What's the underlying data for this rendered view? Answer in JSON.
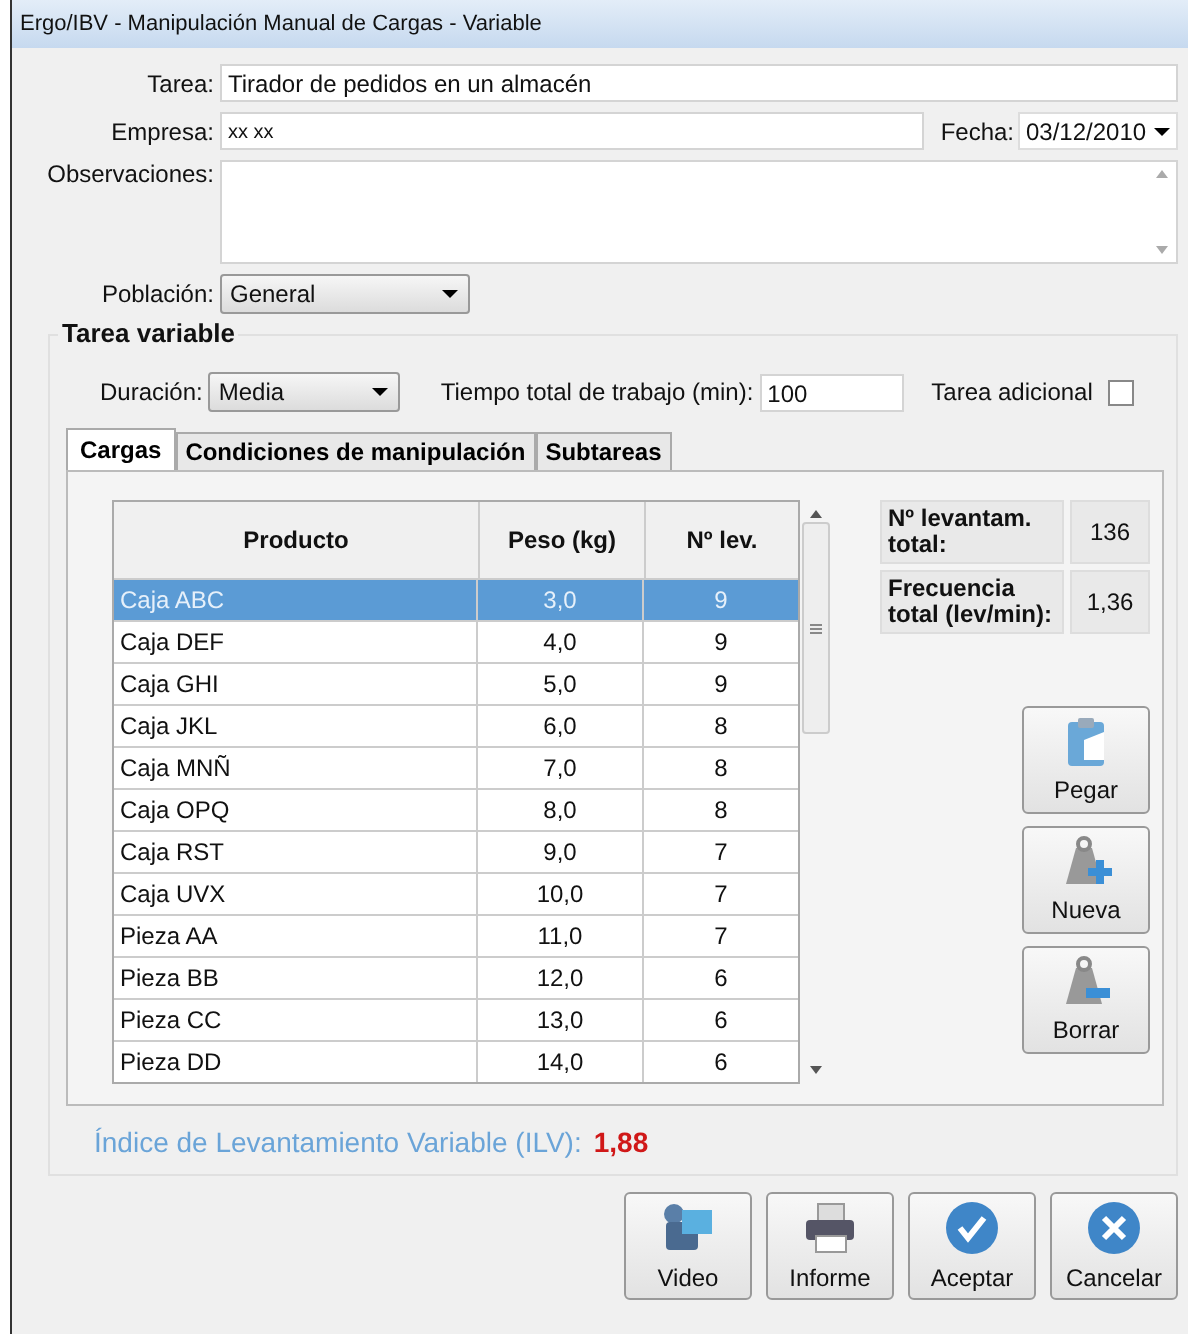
{
  "window": {
    "title": "Ergo/IBV - Manipulación Manual de Cargas - Variable"
  },
  "tarea": {
    "label": "Tarea:",
    "value": "Tirador de pedidos en un almacén"
  },
  "empresa": {
    "label": "Empresa:",
    "value": "xx xx"
  },
  "fecha": {
    "label": "Fecha:",
    "value": "03/12/2010"
  },
  "observaciones": {
    "label": "Observaciones:"
  },
  "poblacion": {
    "label": "Población:",
    "value": "General"
  },
  "group": {
    "title": "Tarea variable",
    "duracion": {
      "label": "Duración:",
      "value": "Media"
    },
    "tiempo": {
      "label": "Tiempo total de trabajo (min):",
      "value": "100"
    },
    "adicional": {
      "label": "Tarea adicional",
      "checked": false
    },
    "tabs": [
      {
        "label": "Cargas",
        "selected": true
      },
      {
        "label": "Condiciones de manipulación",
        "selected": false
      },
      {
        "label": "Subtareas",
        "selected": false
      }
    ],
    "table": {
      "columns": [
        "Producto",
        "Peso (kg)",
        "Nº lev."
      ],
      "rows": [
        {
          "cells": [
            "Caja ABC",
            "3,0",
            "9"
          ],
          "selected": true
        },
        {
          "cells": [
            "Caja DEF",
            "4,0",
            "9"
          ],
          "selected": false
        },
        {
          "cells": [
            "Caja GHI",
            "5,0",
            "9"
          ],
          "selected": false
        },
        {
          "cells": [
            "Caja JKL",
            "6,0",
            "8"
          ],
          "selected": false
        },
        {
          "cells": [
            "Caja MNÑ",
            "7,0",
            "8"
          ],
          "selected": false
        },
        {
          "cells": [
            "Caja OPQ",
            "8,0",
            "8"
          ],
          "selected": false
        },
        {
          "cells": [
            "Caja RST",
            "9,0",
            "7"
          ],
          "selected": false
        },
        {
          "cells": [
            "Caja UVX",
            "10,0",
            "7"
          ],
          "selected": false
        },
        {
          "cells": [
            "Pieza AA",
            "11,0",
            "7"
          ],
          "selected": false
        },
        {
          "cells": [
            "Pieza BB",
            "12,0",
            "6"
          ],
          "selected": false
        },
        {
          "cells": [
            "Pieza CC",
            "13,0",
            "6"
          ],
          "selected": false
        },
        {
          "cells": [
            "Pieza DD",
            "14,0",
            "6"
          ],
          "selected": false
        }
      ]
    },
    "stats": [
      {
        "label": "Nº levantam. total:",
        "value": "136"
      },
      {
        "label": "Frecuencia total (lev/min):",
        "value": "1,36"
      }
    ],
    "side_buttons": [
      {
        "label": "Pegar",
        "kind": "paste"
      },
      {
        "label": "Nueva",
        "kind": "new"
      },
      {
        "label": "Borrar",
        "kind": "delete"
      }
    ],
    "ilv": {
      "label": "Índice de Levantamiento Variable (ILV):",
      "value": "1,88"
    }
  },
  "buttons": [
    {
      "label": "Video",
      "kind": "video"
    },
    {
      "label": "Informe",
      "kind": "print"
    },
    {
      "label": "Aceptar",
      "kind": "ok"
    },
    {
      "label": "Cancelar",
      "kind": "cancel"
    }
  ]
}
